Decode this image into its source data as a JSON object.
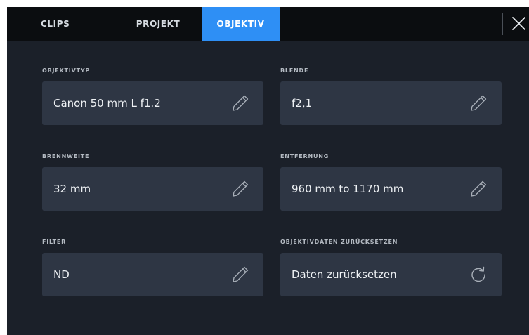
{
  "tabs": [
    {
      "label": "CLIPS",
      "active": false
    },
    {
      "label": "PROJEKT",
      "active": false
    },
    {
      "label": "OBJEKTIV",
      "active": true
    }
  ],
  "close_icon": "close-icon",
  "colors": {
    "background": "#1b2029",
    "tabbar": "#0b0d10",
    "active_tab": "#2e8ff5",
    "field": "#2e3644"
  },
  "fields": {
    "lens_type": {
      "label": "OBJEKTIVTYP",
      "value": "Canon 50 mm L f1.2",
      "icon": "pencil-icon"
    },
    "iris": {
      "label": "BLENDE",
      "value": "f2,1",
      "icon": "pencil-icon"
    },
    "focal_length": {
      "label": "BRENNWEITE",
      "value": "32 mm",
      "icon": "pencil-icon"
    },
    "distance": {
      "label": "ENTFERNUNG",
      "value": "960 mm to 1170 mm",
      "icon": "pencil-icon"
    },
    "filter": {
      "label": "FILTER",
      "value": "ND",
      "icon": "pencil-icon"
    },
    "reset": {
      "label": "OBJEKTIVDATEN ZURÜCKSETZEN",
      "value": "Daten zurücksetzen",
      "icon": "reset-icon"
    }
  }
}
